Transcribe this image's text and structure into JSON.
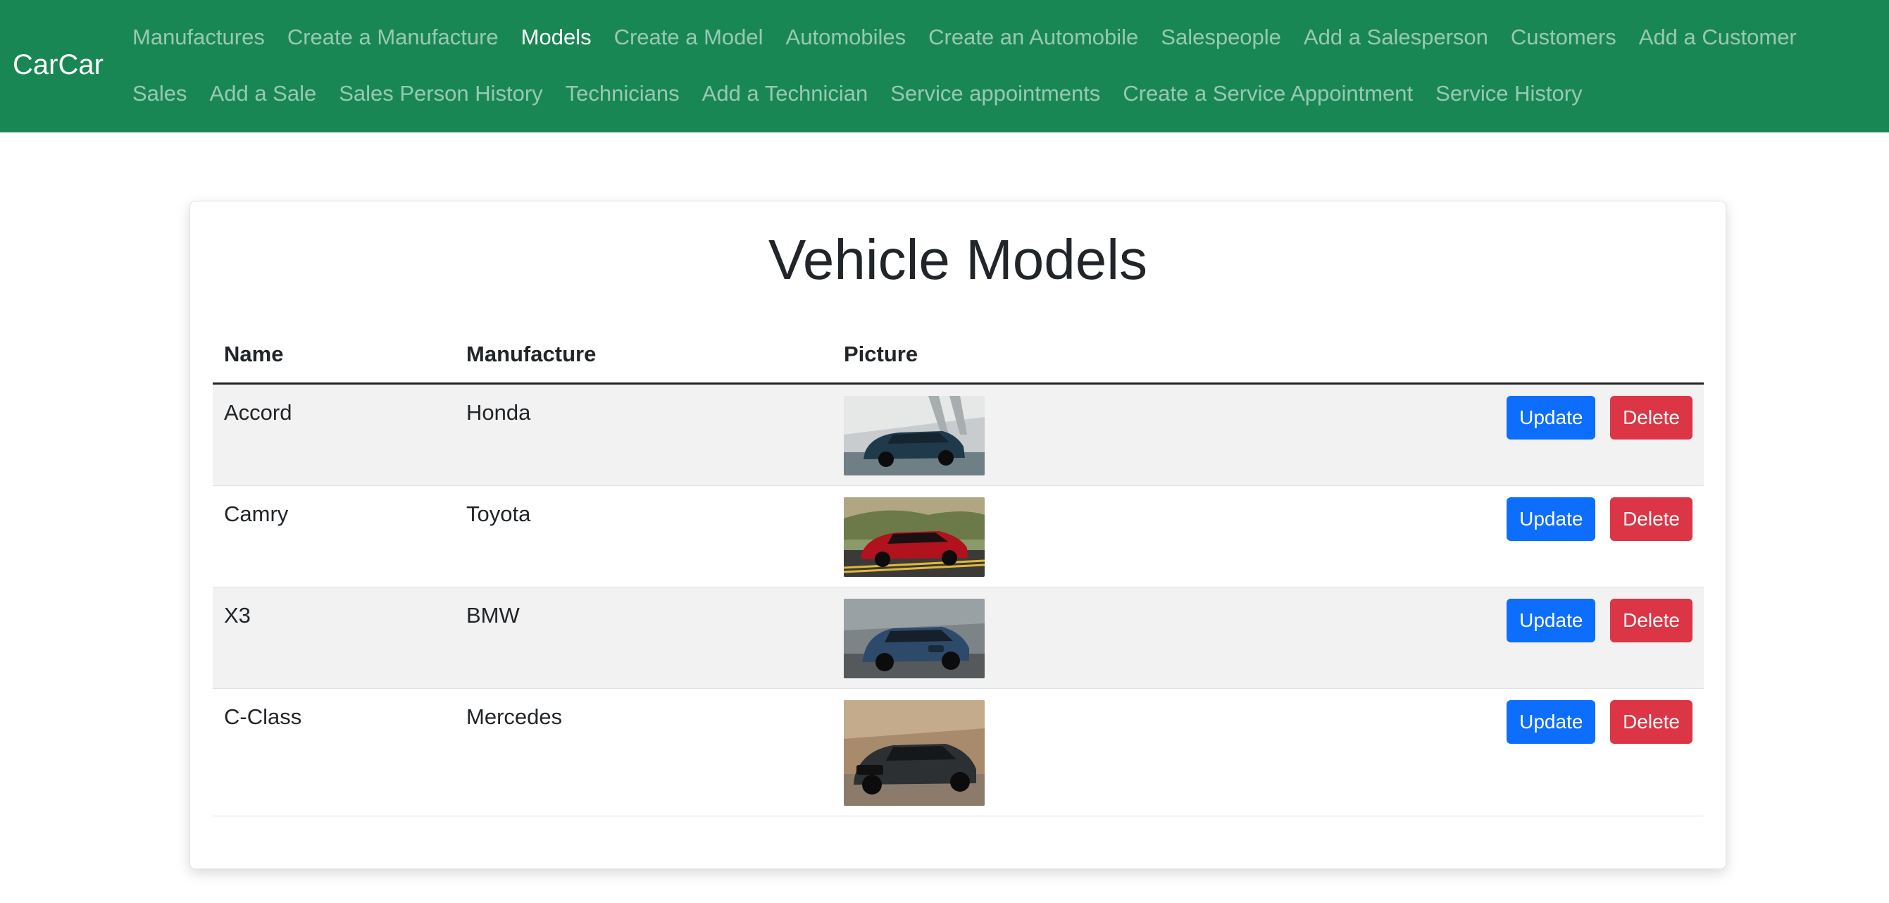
{
  "brand": "CarCar",
  "nav": {
    "row1": [
      {
        "label": "Manufactures",
        "active": false
      },
      {
        "label": "Create a Manufacture",
        "active": false
      },
      {
        "label": "Models",
        "active": true
      },
      {
        "label": "Create a Model",
        "active": false
      },
      {
        "label": "Automobiles",
        "active": false
      },
      {
        "label": "Create an Automobile",
        "active": false
      },
      {
        "label": "Salespeople",
        "active": false
      },
      {
        "label": "Add a Salesperson",
        "active": false
      },
      {
        "label": "Customers",
        "active": false
      },
      {
        "label": "Add a Customer",
        "active": false
      }
    ],
    "row2": [
      {
        "label": "Sales",
        "active": false
      },
      {
        "label": "Add a Sale",
        "active": false
      },
      {
        "label": "Sales Person History",
        "active": false
      },
      {
        "label": "Technicians",
        "active": false
      },
      {
        "label": "Add a Technician",
        "active": false
      },
      {
        "label": "Service appointments",
        "active": false
      },
      {
        "label": "Create a Service Appointment",
        "active": false
      },
      {
        "label": "Service History",
        "active": false
      }
    ]
  },
  "page": {
    "title": "Vehicle Models"
  },
  "table": {
    "headers": {
      "name": "Name",
      "manufacture": "Manufacture",
      "picture": "Picture"
    },
    "rows": [
      {
        "name": "Accord",
        "manufacture": "Honda"
      },
      {
        "name": "Camry",
        "manufacture": "Toyota"
      },
      {
        "name": "X3",
        "manufacture": "BMW"
      },
      {
        "name": "C-Class",
        "manufacture": "Mercedes"
      }
    ],
    "update_label": "Update",
    "delete_label": "Delete"
  },
  "colors": {
    "navbar": "#198754",
    "update_button": "#0d6efd",
    "delete_button": "#dc3545"
  }
}
